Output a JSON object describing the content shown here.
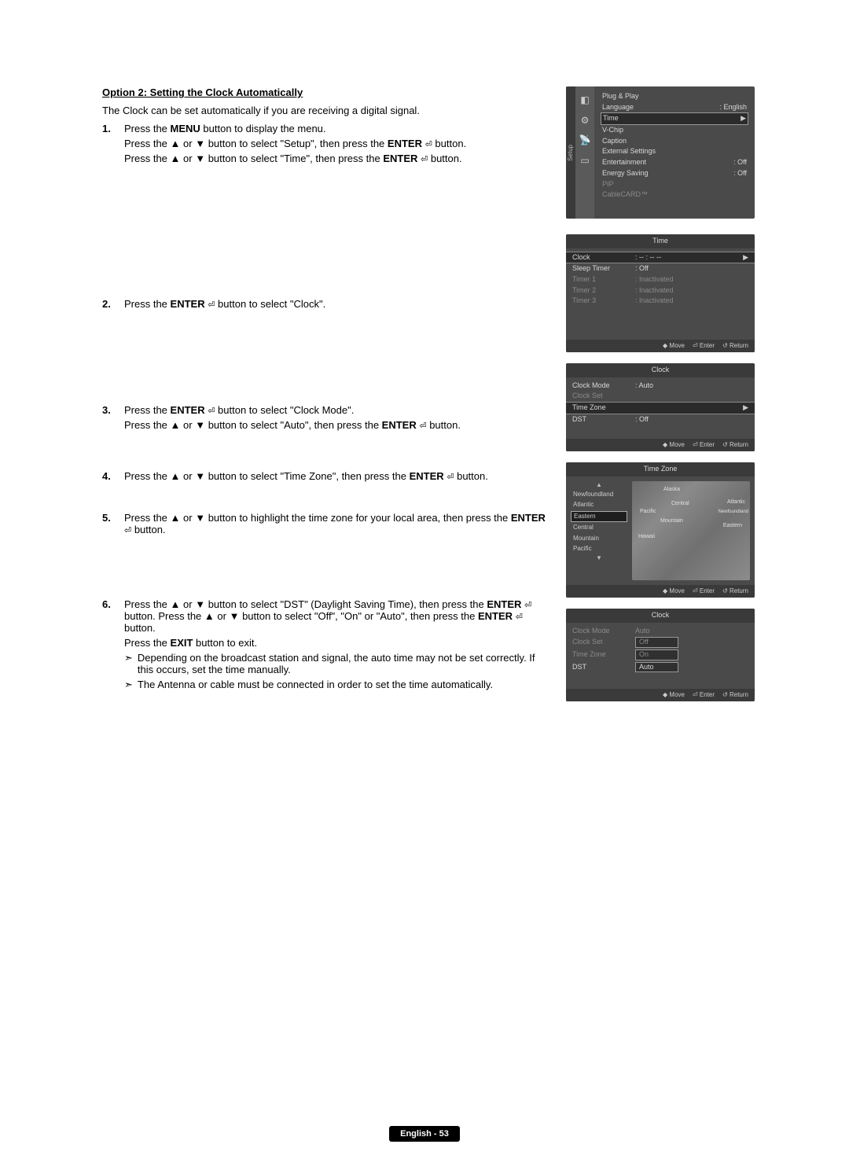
{
  "page": {
    "footer": "English - 53"
  },
  "section": {
    "title": "Option 2: Setting the Clock Automatically",
    "intro": "The Clock can be set automatically if you are receiving a digital signal."
  },
  "glyph": {
    "up": "▲",
    "down": "▼",
    "note": "➣",
    "arrow_right": "▶",
    "move": "◆",
    "return": "↺"
  },
  "labels": {
    "MENU": "MENU",
    "ENTER": "ENTER",
    "EXIT": "EXIT"
  },
  "steps": {
    "s1": {
      "num": "1.",
      "l1a": "Press the ",
      "l1b": " button to display the menu.",
      "l2a": "Press the ",
      "l2b": " or ",
      "l2c": " button to select \"Setup\", then press the ",
      "l2d": " button.",
      "l3a": "Press the ",
      "l3b": " or ",
      "l3c": " button to select \"Time\", then press the ",
      "l3d": " button."
    },
    "s2": {
      "num": "2.",
      "l1a": "Press the ",
      "l1b": " button to select \"Clock\"."
    },
    "s3": {
      "num": "3.",
      "l1a": "Press the ",
      "l1b": " button to select \"Clock Mode\".",
      "l2a": "Press the ",
      "l2b": " or ",
      "l2c": " button to select \"Auto\", then press the ",
      "l2d": " button."
    },
    "s4": {
      "num": "4.",
      "l1a": "Press the ",
      "l1b": " or ",
      "l1c": " button to select \"Time Zone\", then press the ",
      "l1d": " button."
    },
    "s5": {
      "num": "5.",
      "l1a": "Press the ",
      "l1b": " or ",
      "l1c": " button to highlight the time zone for your local area, then press the ",
      "l1d": " button."
    },
    "s6": {
      "num": "6.",
      "l1a": "Press the ",
      "l1b": " or ",
      "l1c": " button to select \"DST\" (Daylight Saving Time), then press the ",
      "l1d": " button. Press the ",
      "l1e": " or ",
      "l1f": " button to select \"Off\", \"On\" or \"Auto\", then press the ",
      "l1g": " button.",
      "l2a": "Press the ",
      "l2b": " button to exit.",
      "note1": "Depending on the broadcast station and signal, the auto time may not be set correctly. If this occurs, set the time manually.",
      "note2": "The Antenna or cable must be connected in order to set the time automatically."
    }
  },
  "osd": {
    "setup": {
      "tab": "Setup",
      "items": [
        {
          "label": "Plug & Play",
          "val": ""
        },
        {
          "label": "Language",
          "val": ": English"
        },
        {
          "label": "Time",
          "val": "",
          "hl": true
        },
        {
          "label": "V-Chip",
          "val": ""
        },
        {
          "label": "Caption",
          "val": ""
        },
        {
          "label": "External Settings",
          "val": ""
        },
        {
          "label": "Entertainment",
          "val": ": Off"
        },
        {
          "label": "Energy Saving",
          "val": ": Off"
        },
        {
          "label": "PIP",
          "val": "",
          "dim": true
        },
        {
          "label": "CableCARD™",
          "val": "",
          "dim": true
        }
      ]
    },
    "time": {
      "title": "Time",
      "items": [
        {
          "label": "Clock",
          "val": ": -- : -- --",
          "hl": true
        },
        {
          "label": "Sleep Timer",
          "val": ": Off"
        },
        {
          "label": "Timer 1",
          "val": ": Inactivated",
          "dim": true
        },
        {
          "label": "Timer 2",
          "val": ": Inactivated",
          "dim": true
        },
        {
          "label": "Timer 3",
          "val": ": Inactivated",
          "dim": true
        }
      ]
    },
    "clock": {
      "title": "Clock",
      "items": [
        {
          "label": "Clock Mode",
          "val": ": Auto"
        },
        {
          "label": "Clock Set",
          "val": "",
          "dim": true
        },
        {
          "label": "Time Zone",
          "val": "",
          "hl": true
        },
        {
          "label": "DST",
          "val": ": Off"
        }
      ]
    },
    "timezone": {
      "title": "Time Zone",
      "items": [
        "Newfoundland",
        "Atlantic",
        "Eastern",
        "Central",
        "Mountain",
        "Pacific"
      ],
      "selected": "Eastern",
      "map_labels": [
        "Alaska",
        "Pacific",
        "Central",
        "Atlantic",
        "Mountain",
        "Eastern",
        "Newfoundland",
        "Hawaii"
      ]
    },
    "clock2": {
      "title": "Clock",
      "items": [
        {
          "label": "Clock Mode",
          "val": "Auto",
          "dim": true
        },
        {
          "label": "Clock Set",
          "val": "Off",
          "dim": true,
          "box": true
        },
        {
          "label": "Time Zone",
          "val": "On",
          "dim": true,
          "box": true
        },
        {
          "label": "DST",
          "val": "Auto",
          "box": true
        }
      ]
    },
    "footer": {
      "move": "Move",
      "enter": "Enter",
      "return": "Return"
    }
  }
}
